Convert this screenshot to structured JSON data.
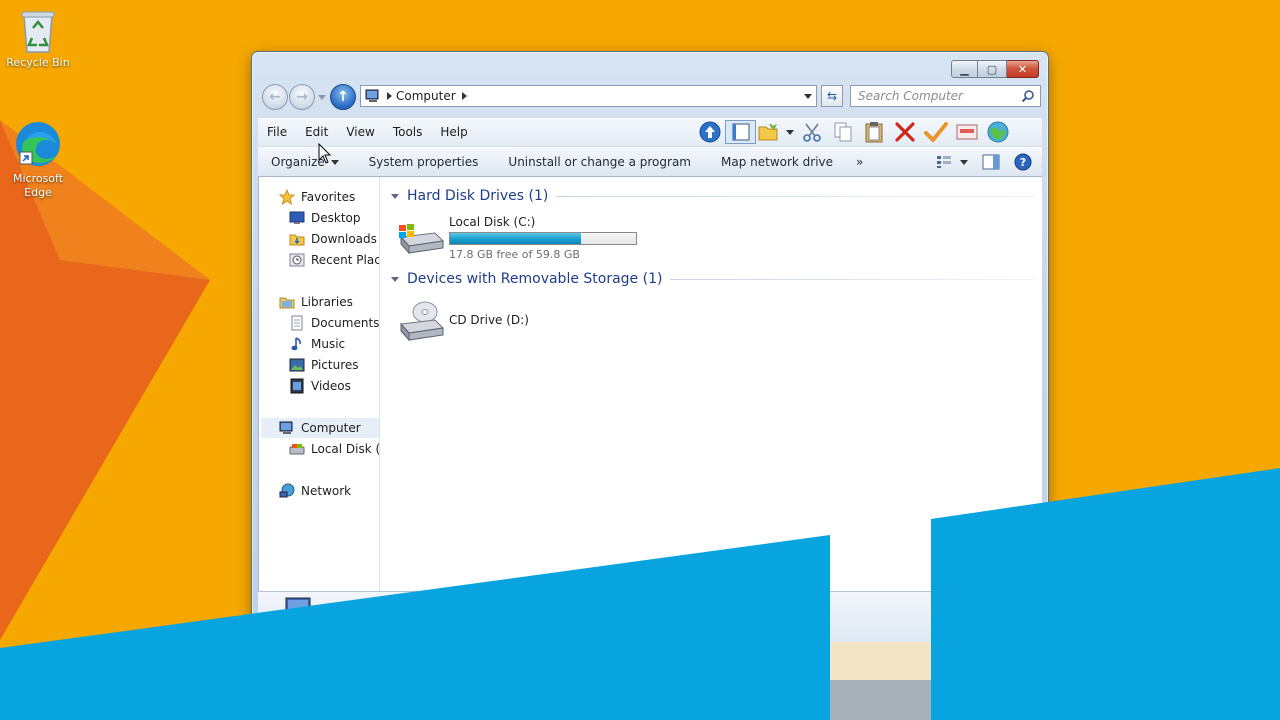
{
  "desktop": {
    "icons": [
      {
        "label": "Recycle Bin",
        "icon": "recycle-bin-icon"
      },
      {
        "label": "Microsoft Edge",
        "icon": "edge-icon"
      }
    ],
    "colors": {
      "background": "#f6a800",
      "accent_orange": "#e8671a",
      "accent_blue": "#08a4e0"
    }
  },
  "window": {
    "caption_buttons": {
      "minimize": "minimize-icon",
      "maximize": "maximize-icon",
      "close": "close-icon"
    },
    "address": {
      "crumb": "Computer"
    },
    "search": {
      "placeholder": "Search Computer"
    },
    "menu": [
      "File",
      "Edit",
      "View",
      "Tools",
      "Help"
    ],
    "toolbar_icons": [
      "up-icon",
      "preview-pane-icon",
      "folder-icon",
      "cut-icon",
      "copy-icon",
      "paste-icon",
      "delete-icon",
      "properties-check-icon",
      "email-icon",
      "globe-icon"
    ],
    "commands": [
      "Organize",
      "System properties",
      "Uninstall or change a program",
      "Map network drive",
      "»"
    ],
    "nav_tree": {
      "favorites": {
        "label": "Favorites",
        "items": [
          "Desktop",
          "Downloads",
          "Recent Places"
        ]
      },
      "libraries": {
        "label": "Libraries",
        "items": [
          "Documents",
          "Music",
          "Pictures",
          "Videos"
        ]
      },
      "computer": {
        "label": "Computer",
        "items": [
          "Local Disk (C:)"
        ]
      },
      "network": {
        "label": "Network"
      }
    },
    "groups": [
      {
        "title": "Hard Disk Drives (1)",
        "drives": [
          {
            "name": "Local Disk (C:)",
            "free_text": "17.8 GB free of 59.8 GB",
            "used_fraction": 0.702
          }
        ]
      },
      {
        "title": "Devices with Removable Storage (1)",
        "drives": [
          {
            "name": "CD Drive (D:)"
          }
        ]
      }
    ]
  }
}
